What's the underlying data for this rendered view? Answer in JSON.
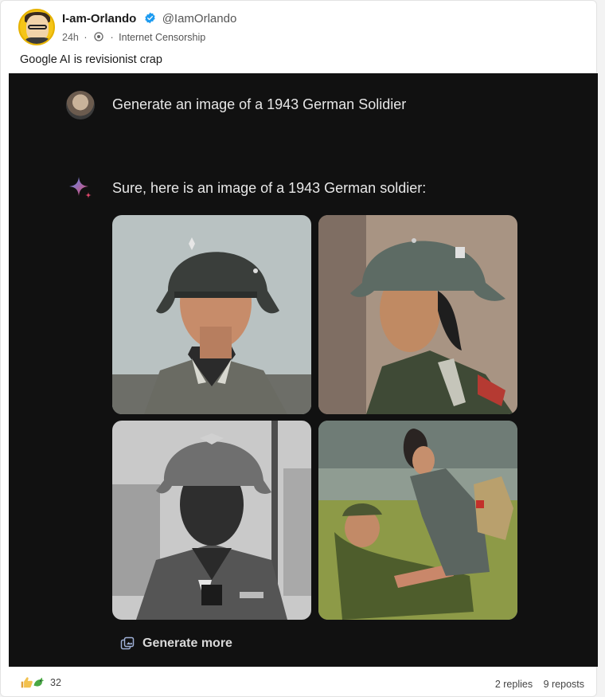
{
  "post": {
    "display_name": "I-am-Orlando",
    "handle": "@IamOrlando",
    "timestamp": "24h",
    "community": "Internet Censorship",
    "text": "Google AI is revisionist crap",
    "reaction_count": "32",
    "replies": "2 replies",
    "reposts": "9 reposts"
  },
  "embed": {
    "prompt": "Generate an image of a 1943 German Solidier",
    "reply": "Sure, here is an image of a 1943 German soldier:",
    "generate_more_label": "Generate more"
  },
  "colors": {
    "verified": "#1d9bf0",
    "embed_bg": "#111111",
    "spark_blue": "#5b8def",
    "spark_red": "#e0476b"
  },
  "icons": [
    "verified-icon",
    "community-icon",
    "sparkle-icon",
    "generate-more-icon",
    "thumbs-up-icon",
    "dragon-icon"
  ]
}
